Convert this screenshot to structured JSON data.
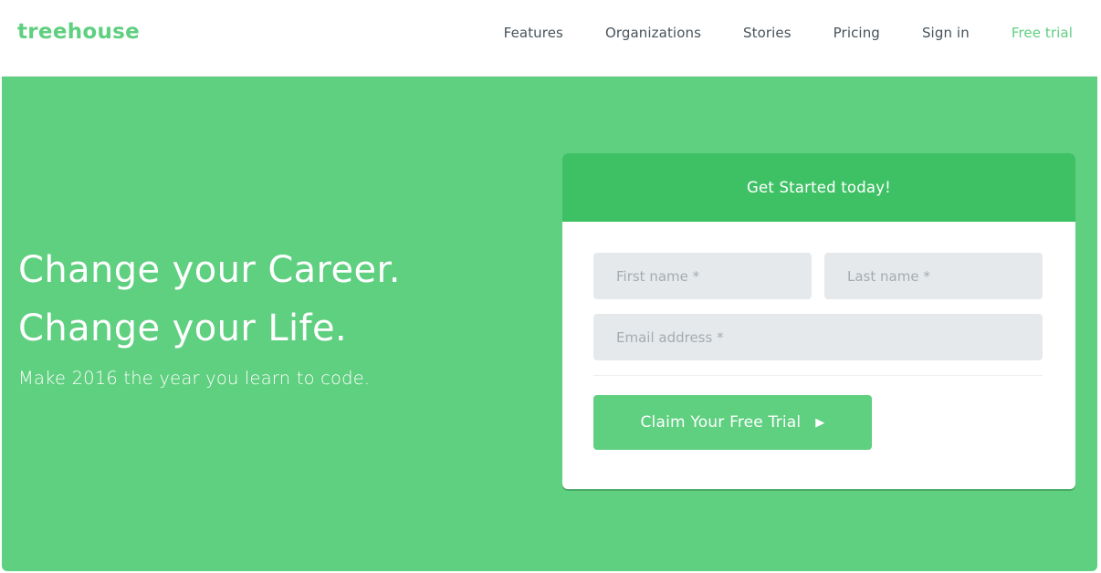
{
  "brand": {
    "logo": "treehouse",
    "accent_color": "#5fcf80",
    "header_green": "#3ec165"
  },
  "nav": {
    "items": [
      {
        "label": "Features"
      },
      {
        "label": "Organizations"
      },
      {
        "label": "Stories"
      },
      {
        "label": "Pricing"
      },
      {
        "label": "Sign in"
      },
      {
        "label": "Free trial"
      }
    ]
  },
  "hero": {
    "headline_line1": "Change your Career.",
    "headline_line2": "Change your Life.",
    "subline": "Make 2016 the year you learn to code."
  },
  "signup": {
    "title": "Get Started today!",
    "first_name_placeholder": "First name *",
    "last_name_placeholder": "Last name *",
    "email_placeholder": "Email address *",
    "first_name_value": "",
    "last_name_value": "",
    "email_value": "",
    "submit_label": "Claim Your Free Trial",
    "submit_icon": "play-arrow-icon",
    "submit_glyph": "▶"
  }
}
